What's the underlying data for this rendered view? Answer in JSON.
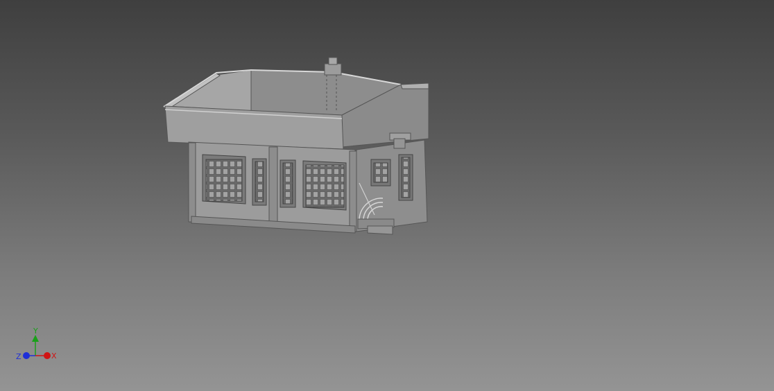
{
  "viewport": {
    "background_top": "#3f3f3f",
    "background_bottom": "#949494"
  },
  "model": {
    "color": "#9a9a9a",
    "edge_color": "#4a4a4a"
  },
  "triad": {
    "x_label": "X",
    "y_label": "Y",
    "z_label": "Z",
    "x_color": "#d01515",
    "y_color": "#19a019",
    "z_color": "#1e2fd8"
  }
}
